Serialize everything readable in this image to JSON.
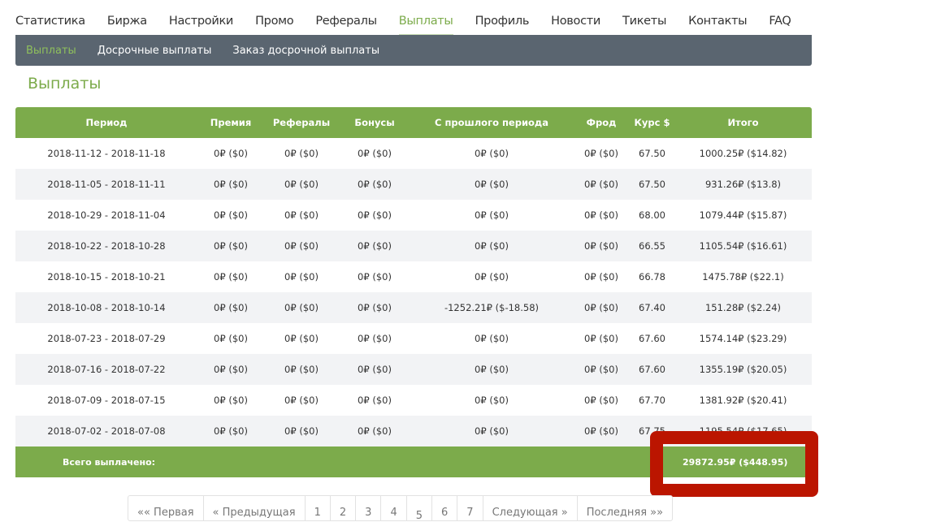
{
  "topnav": [
    {
      "label": "Статистика"
    },
    {
      "label": "Биржа"
    },
    {
      "label": "Настройки"
    },
    {
      "label": "Промо"
    },
    {
      "label": "Рефералы"
    },
    {
      "label": "Выплаты",
      "active": true
    },
    {
      "label": "Профиль"
    },
    {
      "label": "Новости"
    },
    {
      "label": "Тикеты"
    },
    {
      "label": "Контакты"
    },
    {
      "label": "FAQ"
    }
  ],
  "subnav": [
    {
      "label": "Выплаты",
      "active": true
    },
    {
      "label": "Досрочные выплаты"
    },
    {
      "label": "Заказ досрочной выплаты"
    }
  ],
  "page_title": "Выплаты",
  "table": {
    "headers": [
      "Период",
      "Премия",
      "Рефералы",
      "Бонусы",
      "С прошлого периода",
      "Фрод",
      "Курс $",
      "Итого"
    ],
    "rows": [
      [
        "2018-11-12 - 2018-11-18",
        "0₽ ($0)",
        "0₽ ($0)",
        "0₽ ($0)",
        "0₽ ($0)",
        "0₽ ($0)",
        "67.50",
        "1000.25₽ ($14.82)"
      ],
      [
        "2018-11-05 - 2018-11-11",
        "0₽ ($0)",
        "0₽ ($0)",
        "0₽ ($0)",
        "0₽ ($0)",
        "0₽ ($0)",
        "67.50",
        "931.26₽ ($13.8)"
      ],
      [
        "2018-10-29 - 2018-11-04",
        "0₽ ($0)",
        "0₽ ($0)",
        "0₽ ($0)",
        "0₽ ($0)",
        "0₽ ($0)",
        "68.00",
        "1079.44₽ ($15.87)"
      ],
      [
        "2018-10-22 - 2018-10-28",
        "0₽ ($0)",
        "0₽ ($0)",
        "0₽ ($0)",
        "0₽ ($0)",
        "0₽ ($0)",
        "66.55",
        "1105.54₽ ($16.61)"
      ],
      [
        "2018-10-15 - 2018-10-21",
        "0₽ ($0)",
        "0₽ ($0)",
        "0₽ ($0)",
        "0₽ ($0)",
        "0₽ ($0)",
        "66.78",
        "1475.78₽ ($22.1)"
      ],
      [
        "2018-10-08 - 2018-10-14",
        "0₽ ($0)",
        "0₽ ($0)",
        "0₽ ($0)",
        "-1252.21₽ ($-18.58)",
        "0₽ ($0)",
        "67.40",
        "151.28₽ ($2.24)"
      ],
      [
        "2018-07-23 - 2018-07-29",
        "0₽ ($0)",
        "0₽ ($0)",
        "0₽ ($0)",
        "0₽ ($0)",
        "0₽ ($0)",
        "67.60",
        "1574.14₽ ($23.29)"
      ],
      [
        "2018-07-16 - 2018-07-22",
        "0₽ ($0)",
        "0₽ ($0)",
        "0₽ ($0)",
        "0₽ ($0)",
        "0₽ ($0)",
        "67.60",
        "1355.19₽ ($20.05)"
      ],
      [
        "2018-07-09 - 2018-07-15",
        "0₽ ($0)",
        "0₽ ($0)",
        "0₽ ($0)",
        "0₽ ($0)",
        "0₽ ($0)",
        "67.70",
        "1381.92₽ ($20.41)"
      ],
      [
        "2018-07-02 - 2018-07-08",
        "0₽ ($0)",
        "0₽ ($0)",
        "0₽ ($0)",
        "0₽ ($0)",
        "0₽ ($0)",
        "67.75",
        "1195.54₽ ($17.65)"
      ]
    ],
    "footer_label": "Всего выплачено:",
    "footer_total": "29872.95₽ ($448.95)"
  },
  "highlight_color": "#bb1500",
  "pagination": [
    {
      "label": "«« Первая"
    },
    {
      "label": "« Предыдущая"
    },
    {
      "label": "1"
    },
    {
      "label": "2"
    },
    {
      "label": "3"
    },
    {
      "label": "4"
    },
    {
      "label": "5",
      "current": true
    },
    {
      "label": "6"
    },
    {
      "label": "7"
    },
    {
      "label": "Следующая »"
    },
    {
      "label": "Последняя »»"
    }
  ]
}
